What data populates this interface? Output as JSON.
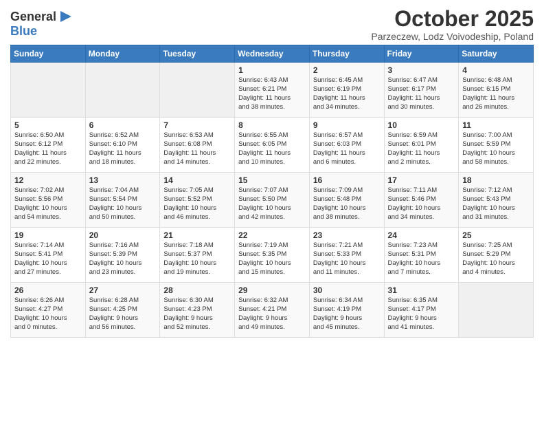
{
  "header": {
    "logo_general": "General",
    "logo_blue": "Blue",
    "month": "October 2025",
    "location": "Parzeczew, Lodz Voivodeship, Poland"
  },
  "weekdays": [
    "Sunday",
    "Monday",
    "Tuesday",
    "Wednesday",
    "Thursday",
    "Friday",
    "Saturday"
  ],
  "weeks": [
    [
      {
        "day": "",
        "content": ""
      },
      {
        "day": "",
        "content": ""
      },
      {
        "day": "",
        "content": ""
      },
      {
        "day": "1",
        "content": "Sunrise: 6:43 AM\nSunset: 6:21 PM\nDaylight: 11 hours\nand 38 minutes."
      },
      {
        "day": "2",
        "content": "Sunrise: 6:45 AM\nSunset: 6:19 PM\nDaylight: 11 hours\nand 34 minutes."
      },
      {
        "day": "3",
        "content": "Sunrise: 6:47 AM\nSunset: 6:17 PM\nDaylight: 11 hours\nand 30 minutes."
      },
      {
        "day": "4",
        "content": "Sunrise: 6:48 AM\nSunset: 6:15 PM\nDaylight: 11 hours\nand 26 minutes."
      }
    ],
    [
      {
        "day": "5",
        "content": "Sunrise: 6:50 AM\nSunset: 6:12 PM\nDaylight: 11 hours\nand 22 minutes."
      },
      {
        "day": "6",
        "content": "Sunrise: 6:52 AM\nSunset: 6:10 PM\nDaylight: 11 hours\nand 18 minutes."
      },
      {
        "day": "7",
        "content": "Sunrise: 6:53 AM\nSunset: 6:08 PM\nDaylight: 11 hours\nand 14 minutes."
      },
      {
        "day": "8",
        "content": "Sunrise: 6:55 AM\nSunset: 6:05 PM\nDaylight: 11 hours\nand 10 minutes."
      },
      {
        "day": "9",
        "content": "Sunrise: 6:57 AM\nSunset: 6:03 PM\nDaylight: 11 hours\nand 6 minutes."
      },
      {
        "day": "10",
        "content": "Sunrise: 6:59 AM\nSunset: 6:01 PM\nDaylight: 11 hours\nand 2 minutes."
      },
      {
        "day": "11",
        "content": "Sunrise: 7:00 AM\nSunset: 5:59 PM\nDaylight: 10 hours\nand 58 minutes."
      }
    ],
    [
      {
        "day": "12",
        "content": "Sunrise: 7:02 AM\nSunset: 5:56 PM\nDaylight: 10 hours\nand 54 minutes."
      },
      {
        "day": "13",
        "content": "Sunrise: 7:04 AM\nSunset: 5:54 PM\nDaylight: 10 hours\nand 50 minutes."
      },
      {
        "day": "14",
        "content": "Sunrise: 7:05 AM\nSunset: 5:52 PM\nDaylight: 10 hours\nand 46 minutes."
      },
      {
        "day": "15",
        "content": "Sunrise: 7:07 AM\nSunset: 5:50 PM\nDaylight: 10 hours\nand 42 minutes."
      },
      {
        "day": "16",
        "content": "Sunrise: 7:09 AM\nSunset: 5:48 PM\nDaylight: 10 hours\nand 38 minutes."
      },
      {
        "day": "17",
        "content": "Sunrise: 7:11 AM\nSunset: 5:46 PM\nDaylight: 10 hours\nand 34 minutes."
      },
      {
        "day": "18",
        "content": "Sunrise: 7:12 AM\nSunset: 5:43 PM\nDaylight: 10 hours\nand 31 minutes."
      }
    ],
    [
      {
        "day": "19",
        "content": "Sunrise: 7:14 AM\nSunset: 5:41 PM\nDaylight: 10 hours\nand 27 minutes."
      },
      {
        "day": "20",
        "content": "Sunrise: 7:16 AM\nSunset: 5:39 PM\nDaylight: 10 hours\nand 23 minutes."
      },
      {
        "day": "21",
        "content": "Sunrise: 7:18 AM\nSunset: 5:37 PM\nDaylight: 10 hours\nand 19 minutes."
      },
      {
        "day": "22",
        "content": "Sunrise: 7:19 AM\nSunset: 5:35 PM\nDaylight: 10 hours\nand 15 minutes."
      },
      {
        "day": "23",
        "content": "Sunrise: 7:21 AM\nSunset: 5:33 PM\nDaylight: 10 hours\nand 11 minutes."
      },
      {
        "day": "24",
        "content": "Sunrise: 7:23 AM\nSunset: 5:31 PM\nDaylight: 10 hours\nand 7 minutes."
      },
      {
        "day": "25",
        "content": "Sunrise: 7:25 AM\nSunset: 5:29 PM\nDaylight: 10 hours\nand 4 minutes."
      }
    ],
    [
      {
        "day": "26",
        "content": "Sunrise: 6:26 AM\nSunset: 4:27 PM\nDaylight: 10 hours\nand 0 minutes."
      },
      {
        "day": "27",
        "content": "Sunrise: 6:28 AM\nSunset: 4:25 PM\nDaylight: 9 hours\nand 56 minutes."
      },
      {
        "day": "28",
        "content": "Sunrise: 6:30 AM\nSunset: 4:23 PM\nDaylight: 9 hours\nand 52 minutes."
      },
      {
        "day": "29",
        "content": "Sunrise: 6:32 AM\nSunset: 4:21 PM\nDaylight: 9 hours\nand 49 minutes."
      },
      {
        "day": "30",
        "content": "Sunrise: 6:34 AM\nSunset: 4:19 PM\nDaylight: 9 hours\nand 45 minutes."
      },
      {
        "day": "31",
        "content": "Sunrise: 6:35 AM\nSunset: 4:17 PM\nDaylight: 9 hours\nand 41 minutes."
      },
      {
        "day": "",
        "content": ""
      }
    ]
  ]
}
